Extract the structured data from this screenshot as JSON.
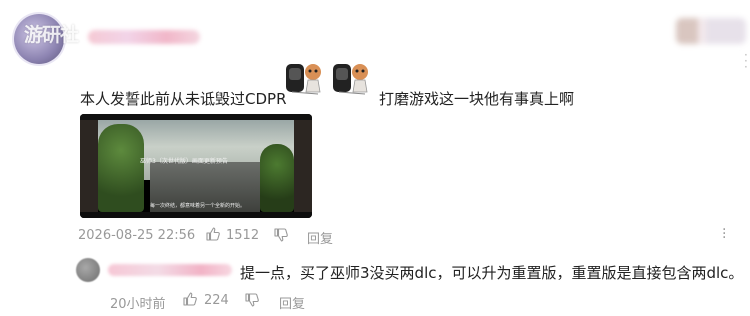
{
  "header": {
    "watermark": "游研社",
    "more_icon": "vertical-dots-icon"
  },
  "post": {
    "text_part1": "本人发誓此前从未诋毁过CDPR",
    "text_part2": "打磨游戏这一块他有事真上啊",
    "thumbnail": {
      "top_text": "",
      "title": "巫师3（次世代版）画面更新预告",
      "subtitle": "每一次终结，都意味着另一个全新的开始。"
    },
    "timestamp": "2026-08-25 22:56",
    "like_count": "1512",
    "reply_label": "回复"
  },
  "reply": {
    "text": "提一点，买了巫师3没买两dlc，可以升为重置版，重置版是直接包含两dlc。",
    "time": "20小时前",
    "like_count": "224",
    "reply_label": "回复"
  },
  "icons": {
    "like": "thumbs-up-icon",
    "dislike": "thumbs-down-icon",
    "more": "vertical-dots-icon"
  }
}
